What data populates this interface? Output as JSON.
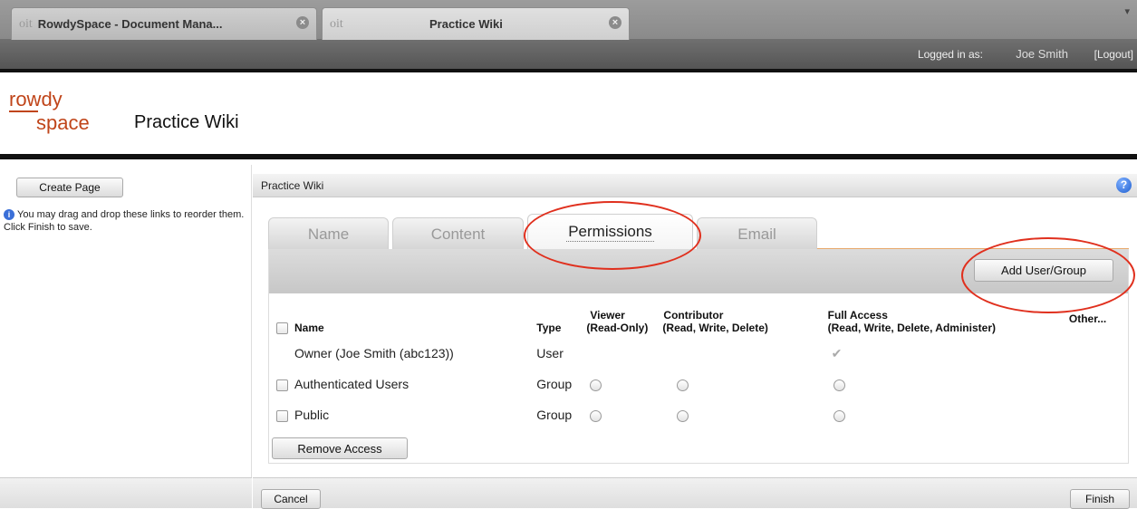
{
  "browser": {
    "tabs": [
      {
        "favicon": "oit",
        "title": "RowdySpace - Document Mana..."
      },
      {
        "favicon": "oit",
        "title": "Practice Wiki"
      }
    ]
  },
  "session": {
    "logged_in_label": "Logged in as:",
    "user_name": "Joe Smith",
    "logout_label": "[Logout]"
  },
  "header": {
    "logo_line1": "rowdy",
    "logo_line2": "space",
    "site_name": "Practice Wiki"
  },
  "sidebar": {
    "create_page_label": "Create Page",
    "hint_text": "You may drag and drop these links to reorder them. Click Finish to save."
  },
  "panel": {
    "title": "Practice Wiki",
    "help_icon": "question-circle-icon",
    "tabs": [
      {
        "label": "Name"
      },
      {
        "label": "Content"
      },
      {
        "label": "Permissions"
      },
      {
        "label": "Email"
      }
    ],
    "active_tab": "Permissions",
    "add_user_group_label": "Add User/Group",
    "columns": {
      "name": "Name",
      "type": "Type",
      "viewer": "Viewer",
      "viewer_sub": "(Read-Only)",
      "contributor": "Contributor",
      "contributor_sub": "(Read, Write, Delete)",
      "full_access": "Full Access",
      "full_access_sub": "(Read, Write, Delete, Administer)",
      "other": "Other..."
    },
    "rows": [
      {
        "name": "Owner (Joe Smith (abc123))",
        "type": "User"
      },
      {
        "name": "Authenticated Users",
        "type": "Group"
      },
      {
        "name": "Public",
        "type": "Group"
      }
    ],
    "remove_access_label": "Remove Access",
    "cancel_label": "Cancel",
    "finish_label": "Finish"
  },
  "colors": {
    "annotation": "#e0301e",
    "logo": "#c0451a"
  }
}
